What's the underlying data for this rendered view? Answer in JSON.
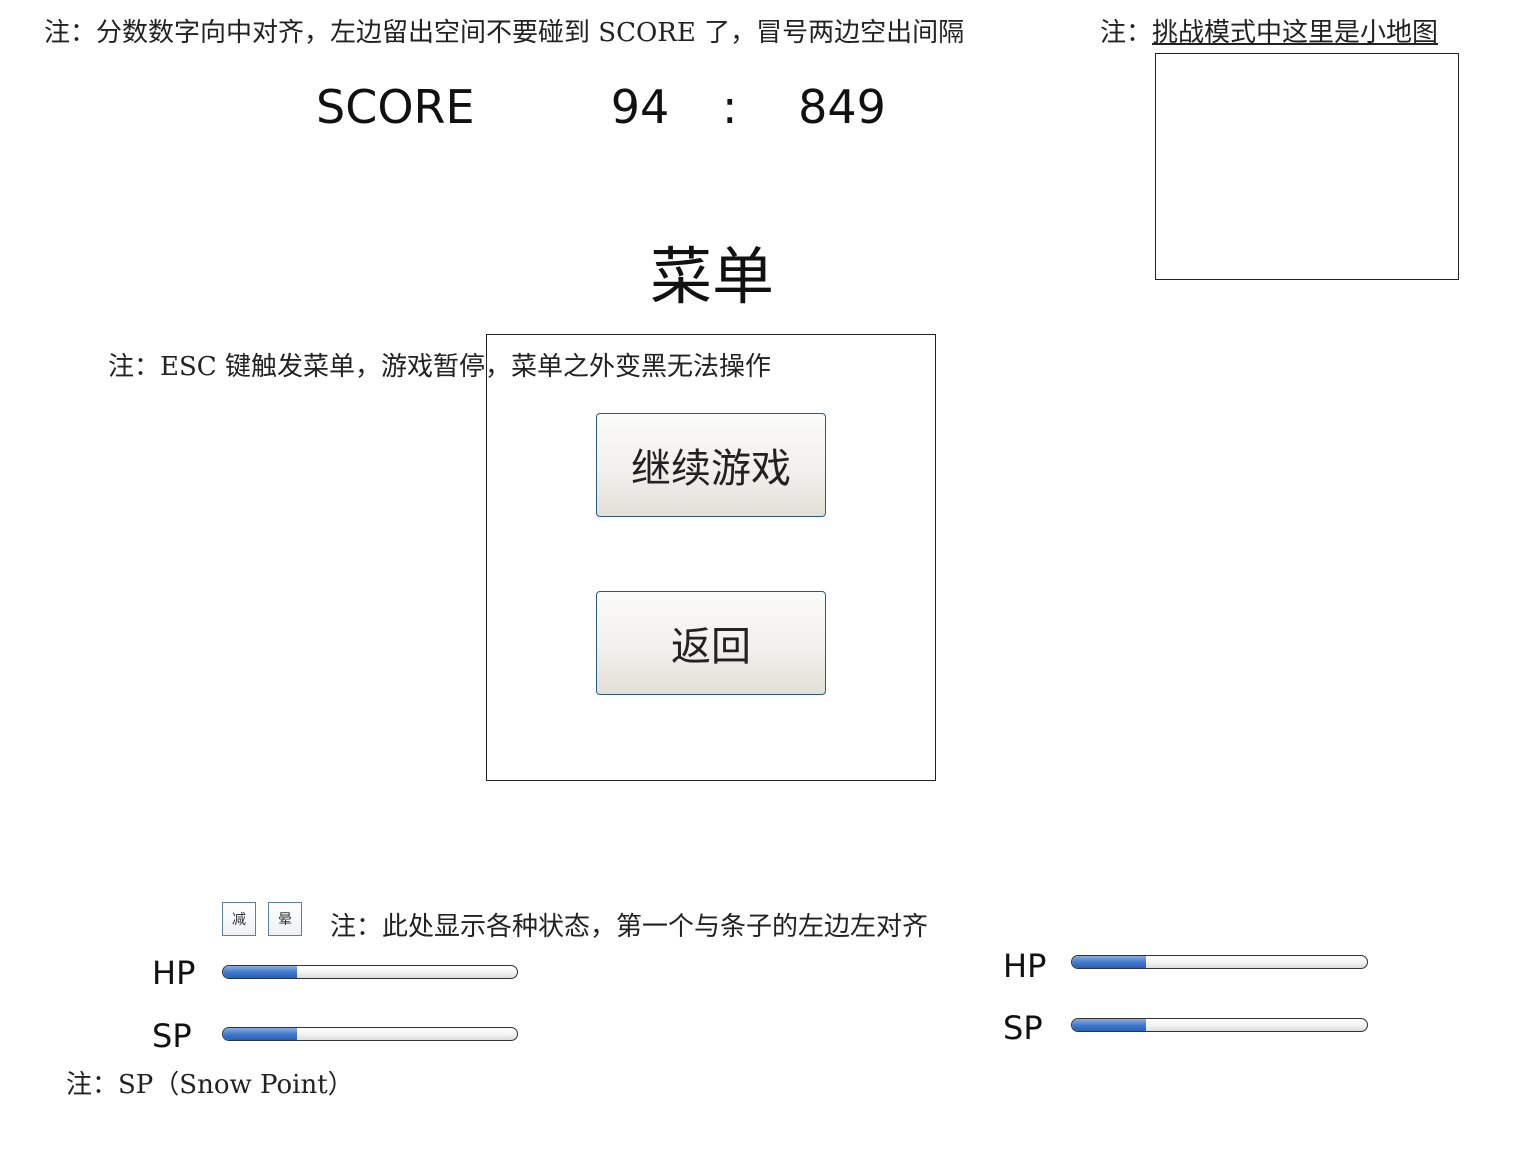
{
  "notes": {
    "score_note": "注：分数数字向中对齐，左边留出空间不要碰到 SCORE 了，冒号两边空出间隔",
    "minimap_note_prefix": "注：",
    "minimap_note_link": "挑战模式中这里是小地图",
    "menu_note": "注：ESC 键触发菜单，游戏暂停，菜单之外变黑无法操作",
    "status_note": "注：此处显示各种状态，第一个与条子的左边左对齐",
    "sp_note": "注：SP（Snow Point）"
  },
  "score": {
    "label": "SCORE",
    "left": "94",
    "separator": ":",
    "right": "849"
  },
  "menu": {
    "title": "菜单",
    "continue_label": "继续游戏",
    "back_label": "返回"
  },
  "status_icons": [
    {
      "glyph": "减",
      "icon": "slow-status-icon"
    },
    {
      "glyph": "晕",
      "icon": "stun-status-icon"
    }
  ],
  "player_left": {
    "hp_label": "HP",
    "hp_fraction": 0.25,
    "sp_label": "SP",
    "sp_fraction": 0.25
  },
  "player_right": {
    "hp_label": "HP",
    "hp_fraction": 0.25,
    "sp_label": "SP",
    "sp_fraction": 0.25
  },
  "colors": {
    "bar_fill": "#3f78cc",
    "button_border": "#2a5a8a"
  }
}
